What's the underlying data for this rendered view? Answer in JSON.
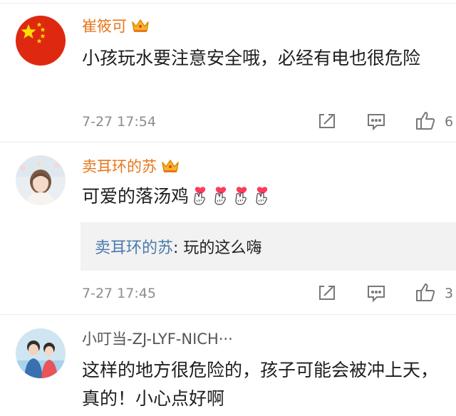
{
  "comments": [
    {
      "username": "崔筱可",
      "text": "小孩玩水要注意安全哦，必经有电也很危险",
      "time": "7-27 17:54",
      "likes": "6",
      "avatar": "china-flag-avatar",
      "badge": "crown-badge"
    },
    {
      "username": "卖耳环的苏",
      "text": "可爱的落汤鸡",
      "emoji": [
        "hand-heart-emoji",
        "hand-heart-emoji",
        "hand-heart-emoji",
        "hand-heart-emoji"
      ],
      "time": "7-27 17:45",
      "likes": "3",
      "avatar": "girl-photo-avatar",
      "badge": "crown-badge",
      "reply": {
        "author": "卖耳环的苏",
        "separator": ": ",
        "text": "玩的这么嗨"
      }
    },
    {
      "username": "小叮当-ZJ-LYF-NICH···",
      "text": "这样的地方很危险的，孩子可能会被冲上天，真的！小心点好啊",
      "avatar": "couple-photo-avatar"
    }
  ],
  "colors": {
    "username": "#e8761b",
    "reply_name": "#4a7aac",
    "meta": "#8c8c8c",
    "reply_bg": "#f2f2f2"
  }
}
